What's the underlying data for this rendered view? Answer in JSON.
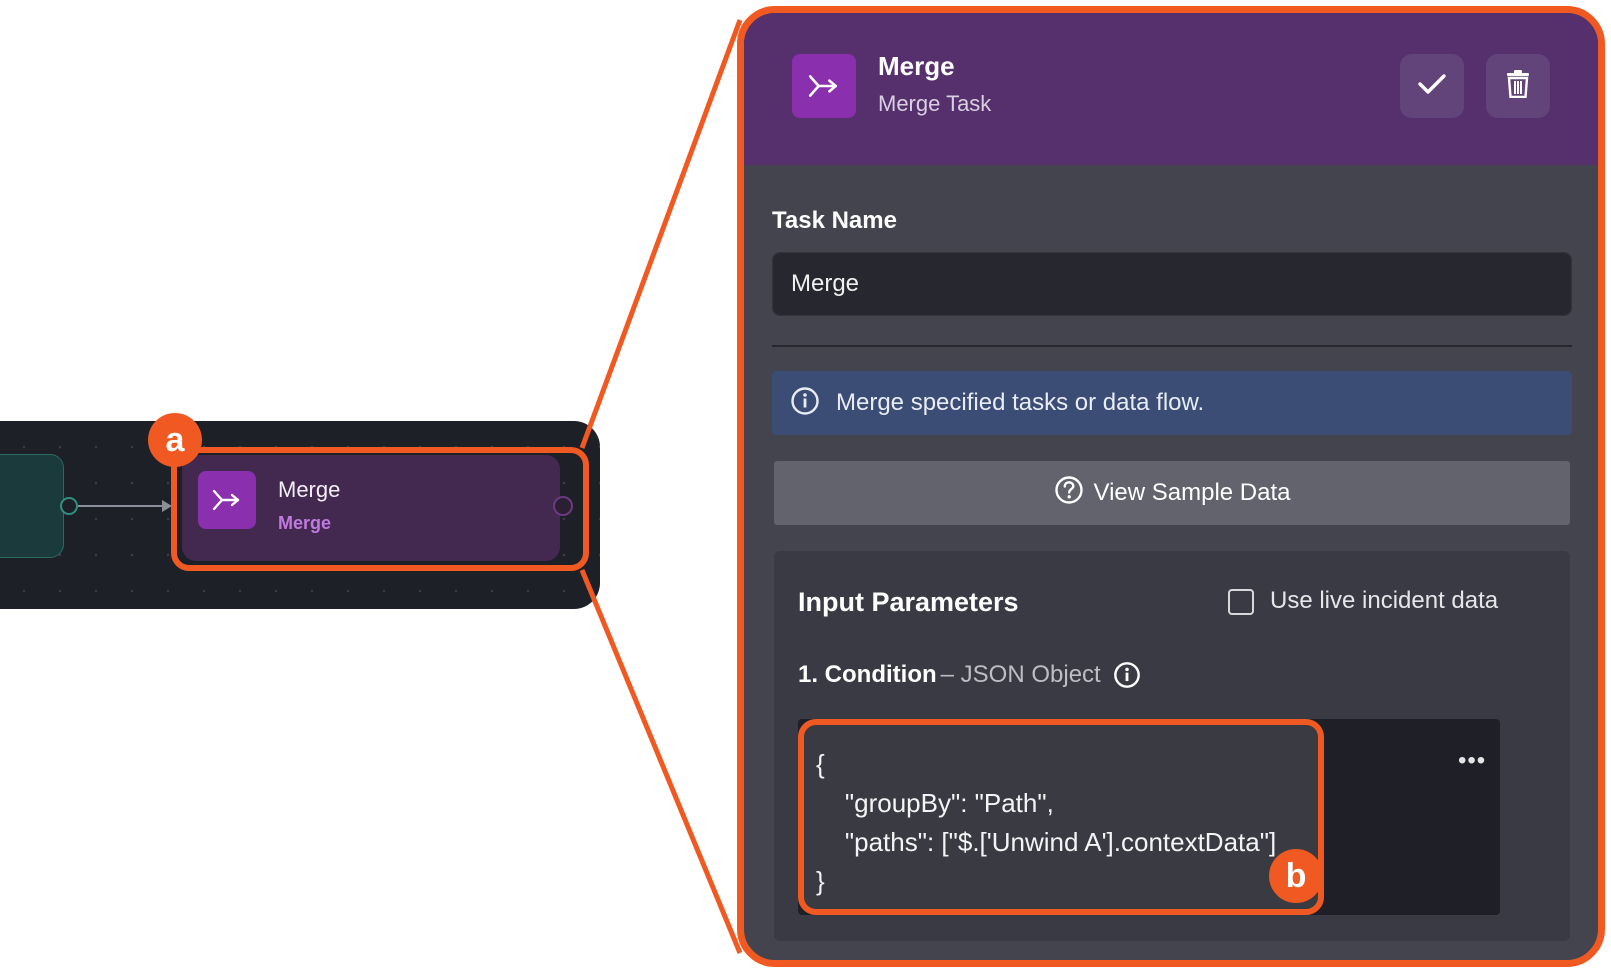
{
  "canvas": {
    "node": {
      "title": "Merge",
      "subtitle": "Merge"
    }
  },
  "callouts": {
    "a": "a",
    "b": "b"
  },
  "panel": {
    "header": {
      "title": "Merge",
      "subtitle": "Merge Task"
    },
    "task_name_label": "Task Name",
    "task_name_value": "Merge",
    "info_text": "Merge specified tasks or data flow.",
    "sample_button": "View Sample Data",
    "params": {
      "title": "Input Parameters",
      "live_label": "Use live incident data",
      "condition_name": "1. Condition",
      "condition_type": "– JSON Object",
      "code_lines": [
        "{",
        "    \"groupBy\": \"Path\",",
        "    \"paths\": [\"$.['Unwind A'].contextData\"]",
        "}"
      ],
      "menu": "•••"
    }
  },
  "colors": {
    "accent": "#f05a22",
    "header": "#55306d",
    "icon_bg": "#8a2fae",
    "info": "#3b4c75"
  },
  "icons": [
    "merge-icon",
    "check-icon",
    "trash-icon",
    "info-icon",
    "help-circle-icon"
  ]
}
